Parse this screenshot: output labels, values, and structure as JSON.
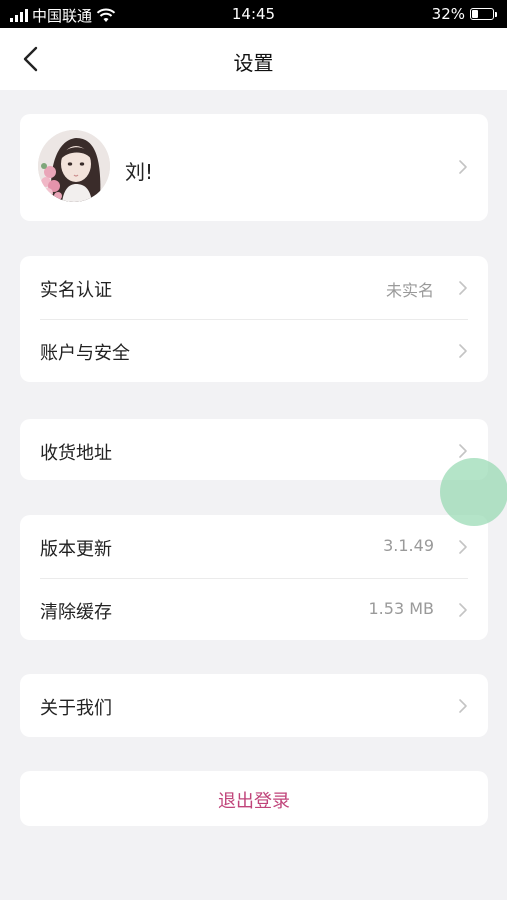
{
  "status_bar": {
    "carrier": "中国联通",
    "time": "14:45",
    "battery_percent": "32%",
    "battery_level": 0.32
  },
  "nav": {
    "title": "设置",
    "back_icon": "chevron-left-icon"
  },
  "profile": {
    "name": "刘!"
  },
  "group1": {
    "realname": {
      "label": "实名认证",
      "value": "未实名"
    },
    "account": {
      "label": "账户与安全"
    }
  },
  "group2": {
    "address": {
      "label": "收货地址"
    }
  },
  "group3": {
    "version": {
      "label": "版本更新",
      "value": "3.1.49"
    },
    "cache": {
      "label": "清除缓存",
      "value": "1.53 MB"
    }
  },
  "group4": {
    "about": {
      "label": "关于我们"
    }
  },
  "logout": {
    "label": "退出登录"
  },
  "colors": {
    "accent": "#c0447a",
    "background": "#f2f2f4",
    "touch_indicator": "#8cd6aa"
  }
}
